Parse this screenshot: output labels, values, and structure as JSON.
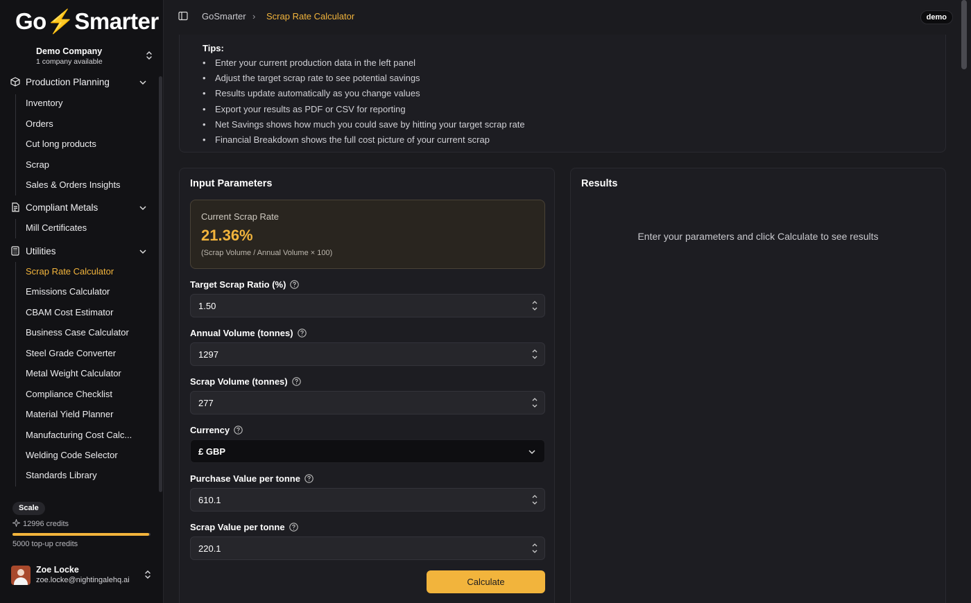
{
  "app": {
    "logo_pre": "Go",
    "logo_bolt": "⚡",
    "logo_post": "Smarter",
    "company_name": "Demo Company",
    "company_sub": "1 company available"
  },
  "sidebar": {
    "groups": [
      {
        "label": "Production Planning",
        "icon": "box-icon",
        "items": [
          "Inventory",
          "Orders",
          "Cut long products",
          "Scrap",
          "Sales & Orders Insights"
        ]
      },
      {
        "label": "Compliant Metals",
        "icon": "document-icon",
        "items": [
          "Mill Certificates"
        ]
      },
      {
        "label": "Utilities",
        "icon": "calculator-icon",
        "items": [
          "Scrap Rate Calculator",
          "Emissions Calculator",
          "CBAM Cost Estimator",
          "Business Case Calculator",
          "Steel Grade Converter",
          "Metal Weight Calculator",
          "Compliance Checklist",
          "Material Yield Planner",
          "Manufacturing Cost Calc...",
          "Welding Code Selector",
          "Standards Library"
        ]
      }
    ],
    "active_item": "Scrap Rate Calculator",
    "plan": "Scale",
    "credits": "12996 credits",
    "credits_fraction": 0.99,
    "topup": "5000 top-up credits",
    "user_name": "Zoe Locke",
    "user_email": "zoe.locke@nightingalehq.ai"
  },
  "topbar": {
    "crumb_home": "GoSmarter",
    "crumb_sep": "›",
    "crumb_current": "Scrap Rate Calculator",
    "badge": "demo"
  },
  "tips": {
    "title": "Tips:",
    "items": [
      "Enter your current production data in the left panel",
      "Adjust the target scrap rate to see potential savings",
      "Results update automatically as you change values",
      "Export your results as PDF or CSV for reporting",
      "Net Savings shows how much you could save by hitting your target scrap rate",
      "Financial Breakdown shows the full cost picture of your current scrap"
    ]
  },
  "input": {
    "title": "Input Parameters",
    "rate_label": "Current Scrap Rate",
    "rate_value": "21.36%",
    "rate_formula": "(Scrap Volume / Annual Volume × 100)",
    "target_label": "Target Scrap Ratio (%)",
    "target_value": "1.50",
    "annual_label": "Annual Volume (tonnes)",
    "annual_value": "1297",
    "scrapvol_label": "Scrap Volume (tonnes)",
    "scrapvol_value": "277",
    "currency_label": "Currency",
    "currency_value": "£ GBP",
    "purchase_label": "Purchase Value per tonne",
    "purchase_value": "610.1",
    "scrapval_label": "Scrap Value per tonne",
    "scrapval_value": "220.1",
    "calculate_label": "Calculate"
  },
  "results": {
    "title": "Results",
    "message": "Enter your parameters and click Calculate to see results"
  },
  "colors": {
    "accent": "#f2b43c",
    "background": "#1b1b1f",
    "sidebar": "#121215"
  }
}
